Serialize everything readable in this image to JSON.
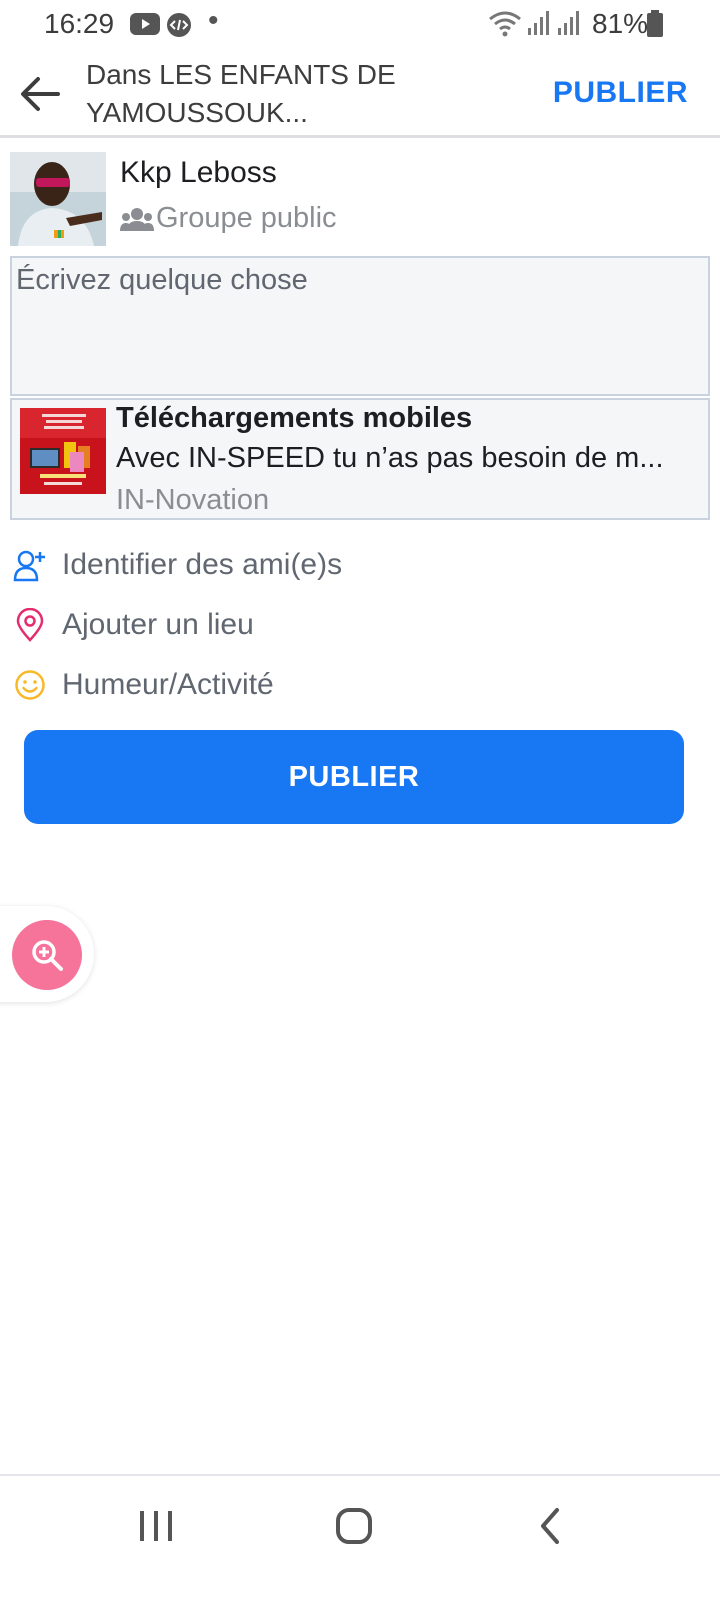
{
  "status_bar": {
    "time": "16:29",
    "battery_text": "81%",
    "icons": [
      "youtube-icon",
      "code-icon",
      "notification-dot",
      "wifi-icon",
      "signal-icon",
      "signal-icon",
      "battery-icon"
    ]
  },
  "header": {
    "title": "Dans LES ENFANTS DE YAMOUSSOUK...",
    "publish_label": "PUBLIER",
    "back_icon": "arrow-left-icon"
  },
  "user": {
    "name": "Kkp Leboss",
    "audience_icon": "group-icon",
    "audience": "Groupe public"
  },
  "composer": {
    "placeholder": "Écrivez quelque chose",
    "value": ""
  },
  "link_preview": {
    "title": "Téléchargements mobiles",
    "description": "Avec IN-SPEED tu n’as pas besoin de m...",
    "source": "IN-Novation"
  },
  "actions": [
    {
      "label": "Identifier des ami(e)s",
      "icon": "tag-friend-icon",
      "color": "#1877f2"
    },
    {
      "label": "Ajouter un lieu",
      "icon": "location-pin-icon",
      "color": "#e42d6e"
    },
    {
      "label": "Humeur/Activité",
      "icon": "smiley-icon",
      "color": "#f7b928"
    }
  ],
  "publish_button": {
    "label": "PUBLIER"
  },
  "floating": {
    "icon": "zoom-in-icon"
  },
  "nav": [
    "recent-apps-icon",
    "home-icon",
    "back-icon"
  ],
  "colors": {
    "accent": "#1877f2",
    "zoom_button": "#f6739a",
    "muted_text": "#8a8d91"
  }
}
